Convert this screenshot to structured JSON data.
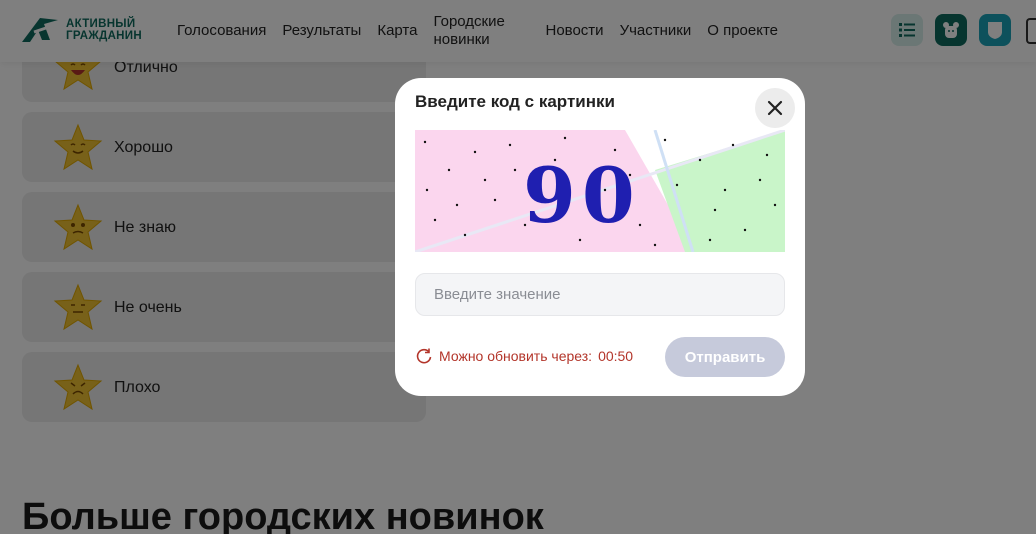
{
  "header": {
    "logo_line1": "АКТИВНЫЙ",
    "logo_line2": "ГРАЖДАНИН",
    "nav": [
      {
        "label": "Голосования"
      },
      {
        "label": "Результаты"
      },
      {
        "label": "Карта"
      },
      {
        "label": "Городские новинки"
      },
      {
        "label": "Новости"
      },
      {
        "label": "Участники"
      },
      {
        "label": "О проекте"
      }
    ],
    "icons": [
      "list-icon",
      "bear-icon",
      "shield-icon"
    ],
    "brand_color": "#0f6b5e"
  },
  "ratings": [
    {
      "label": "Отлично",
      "face": "laughing"
    },
    {
      "label": "Хорошо",
      "face": "content"
    },
    {
      "label": "Не знаю",
      "face": "confused"
    },
    {
      "label": "Не очень",
      "face": "neutral"
    },
    {
      "label": "Плохо",
      "face": "sad"
    }
  ],
  "section_title": "Больше городских новинок",
  "modal": {
    "title": "Введите код с картинки",
    "captcha_digits": "90",
    "input_placeholder": "Введите значение",
    "input_value": "",
    "refresh_label": "Можно обновить через:",
    "refresh_timer": "00:50",
    "submit_label": "Отправить",
    "accent_red": "#b3352a",
    "submit_disabled_color": "#c6cadb"
  }
}
